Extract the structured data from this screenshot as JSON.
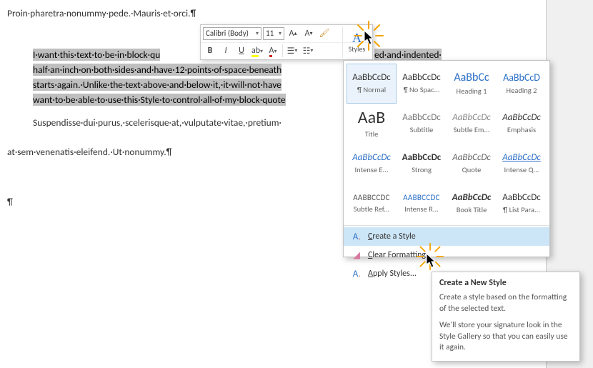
{
  "doc": {
    "line_top": "Proin·pharetra·nonummy·pede.·Mauris·et·orci.¶",
    "sel1": "I·want·this·text·to·be·in·block·qu",
    "sel1_tail": "ed·and·indented·",
    "sel2": "half·an·inch·on·both·sides·and·have·12·points·of·space·beneath",
    "sel3": "starts·again.·Unlike·the·text·above·and·below·it,·it·will·not·have",
    "sel4": "want·to·be·able·to·use·this·Style·to·control·all·of·my·block·quote",
    "after1": "Suspendisse·dui·purus,·scelerisque·at,·vulputate·vitae,·pretium·",
    "after2": "at·sem·venenatis·eleifend.·Ut·nonummy.¶",
    "pilcrow": "¶"
  },
  "mini": {
    "font_name": "Calibri (Body)",
    "font_size": "11",
    "styles_label": "Styles"
  },
  "gallery": {
    "items": [
      {
        "preview": "AaBbCcDc",
        "label": "¶ Normal",
        "style": "color:#333"
      },
      {
        "preview": "AaBbCcDc",
        "label": "¶ No Spac...",
        "style": "color:#333"
      },
      {
        "preview": "AaBbCc",
        "label": "Heading 1",
        "style": "color:#2a6ec6;font-size:16px"
      },
      {
        "preview": "AaBbCcD",
        "label": "Heading 2",
        "style": "color:#2a6ec6;font-size:14px"
      },
      {
        "preview": "AaB",
        "label": "Title",
        "style": "color:#333;font-size:24px"
      },
      {
        "preview": "AaBbCcDc",
        "label": "Subtitle",
        "style": "color:#777"
      },
      {
        "preview": "AaBbCcDc",
        "label": "Subtle Em...",
        "style": "color:#888;font-style:italic"
      },
      {
        "preview": "AaBbCcDc",
        "label": "Emphasis",
        "style": "color:#333;font-style:italic"
      },
      {
        "preview": "AaBbCcDc",
        "label": "Intense E...",
        "style": "color:#2a6ec6;font-style:italic"
      },
      {
        "preview": "AaBbCcDc",
        "label": "Strong",
        "style": "color:#333;font-weight:bold"
      },
      {
        "preview": "AaBbCcDc",
        "label": "Quote",
        "style": "color:#666;font-style:italic"
      },
      {
        "preview": "AaBbCcDc",
        "label": "Intense Q...",
        "style": "color:#2a6ec6;font-style:italic;text-decoration:underline"
      },
      {
        "preview": "AABBCCDC",
        "label": "Subtle Ref...",
        "style": "color:#555;font-size:11px;letter-spacing:.3px"
      },
      {
        "preview": "AABBCCDC",
        "label": "Intense R...",
        "style": "color:#2a6ec6;font-size:11px;letter-spacing:.3px"
      },
      {
        "preview": "AaBbCcDc",
        "label": "Book Title",
        "style": "color:#333;font-weight:bold;font-style:italic"
      },
      {
        "preview": "AaBbCcDc",
        "label": "¶ List Para...",
        "style": "color:#333"
      }
    ],
    "menu": {
      "create_pre": "",
      "create_u": "C",
      "create_rest": "reate a Style",
      "clear_pre": "",
      "clear_u": "C",
      "clear_rest": "lear Formatting",
      "apply_pre": "",
      "apply_u": "A",
      "apply_rest": "pply Styles..."
    }
  },
  "tooltip": {
    "title": "Create a New Style",
    "p1": "Create a style based on the formatting of the selected text.",
    "p2": "We'll store your signature look in the Style Gallery so that you can easily use it again."
  }
}
